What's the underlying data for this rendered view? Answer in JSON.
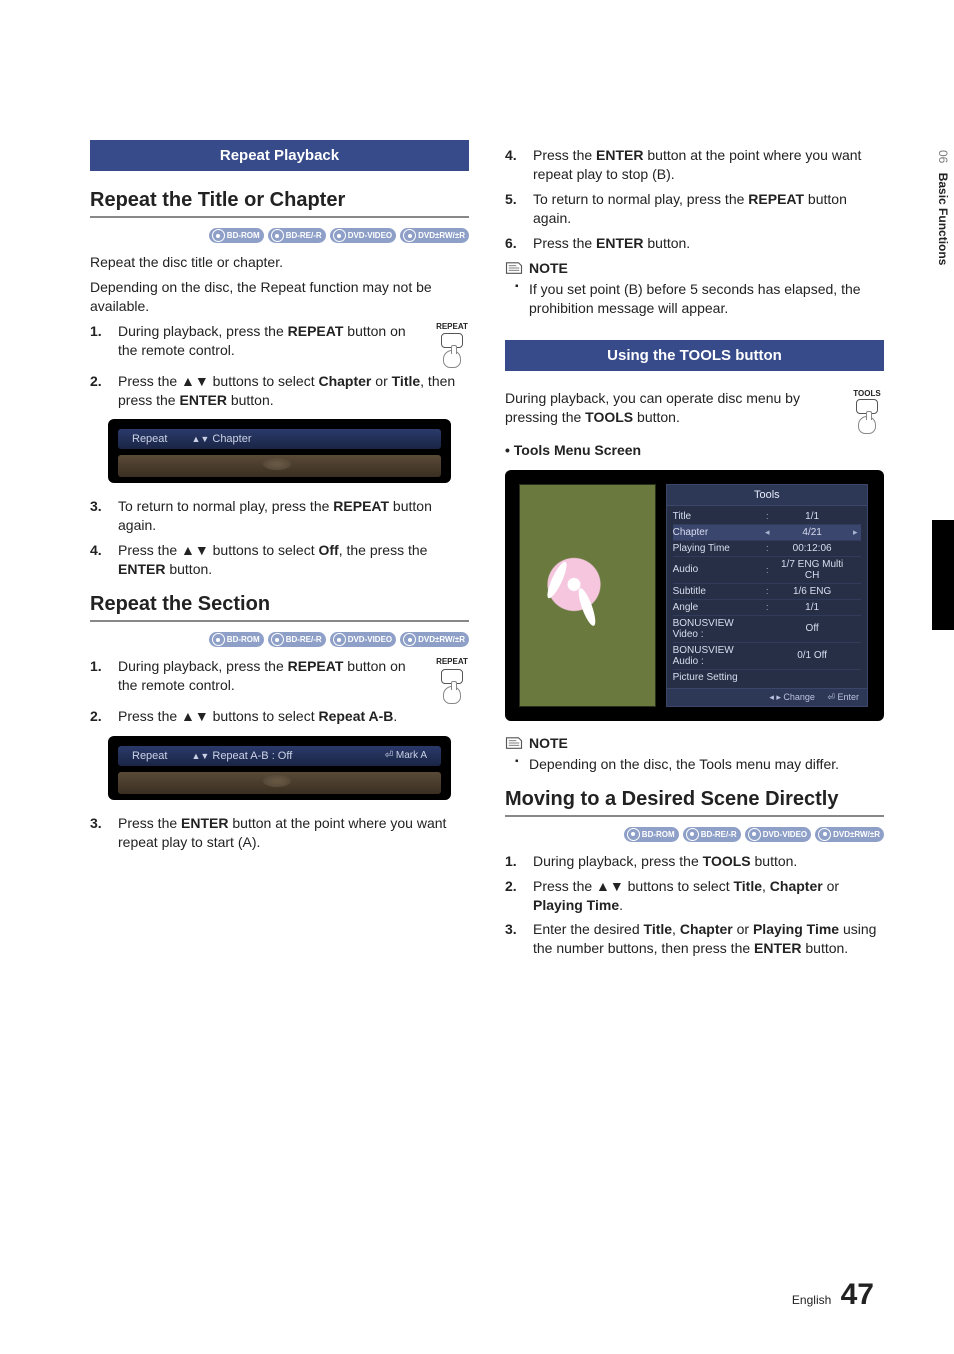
{
  "side": {
    "section_number": "06",
    "section_title": "Basic Functions"
  },
  "footer": {
    "lang": "English",
    "page": "47"
  },
  "left": {
    "banner": "Repeat Playback",
    "h_title_chapter": "Repeat the Title or Chapter",
    "disc_badges": [
      "BD-ROM",
      "BD-RE/-R",
      "DVD-VIDEO",
      "DVD±RW/±R"
    ],
    "intro1": "Repeat the disc title or chapter.",
    "intro2": "Depending on the disc, the Repeat function may not be available.",
    "remote_btn_label": "REPEAT",
    "steps_a": [
      {
        "n": "1.",
        "pre": "During playback, press the ",
        "bold": "REPEAT",
        "post": " button on the remote control."
      },
      {
        "n": "2.",
        "parts": [
          "Press the ",
          "▲▼",
          " buttons to select ",
          "Chapter",
          " or ",
          "Title",
          ", then press the ",
          "ENTER",
          " button."
        ]
      },
      {
        "n": "3.",
        "parts": [
          "To return to normal play, press the ",
          "REPEAT",
          " button again."
        ]
      },
      {
        "n": "4.",
        "parts": [
          "Press the ",
          "▲▼",
          " buttons to select ",
          "Off",
          ", the press the ",
          "ENTER",
          " button."
        ]
      }
    ],
    "osd1": {
      "label": "Repeat",
      "arrows": "▲▼",
      "value": "Chapter"
    },
    "h_section": "Repeat the Section",
    "disc_badges2": [
      "BD-ROM",
      "BD-RE/-R",
      "DVD-VIDEO",
      "DVD±RW/±R"
    ],
    "steps_b": [
      {
        "n": "1.",
        "parts": [
          "During playback, press the ",
          "REPEAT",
          " button on the remote control."
        ]
      },
      {
        "n": "2.",
        "parts": [
          "Press the ",
          "▲▼",
          " buttons to select ",
          "Repeat A-B",
          "."
        ]
      },
      {
        "n": "3.",
        "parts": [
          "Press the ",
          "ENTER",
          " button at the point where you want repeat play to start (A)."
        ]
      }
    ],
    "osd2": {
      "label": "Repeat",
      "arrows": "▲▼",
      "value": "Repeat A-B : Off",
      "enter_glyph": "⏎",
      "enter_label": "Mark A"
    }
  },
  "right": {
    "steps_c": [
      {
        "n": "4.",
        "parts": [
          "Press the ",
          "ENTER",
          " button at the point where you want repeat play to stop (B)."
        ]
      },
      {
        "n": "5.",
        "parts": [
          "To return to normal play, press the ",
          "REPEAT",
          " button again."
        ]
      },
      {
        "n": "6.",
        "parts": [
          "Press the ",
          "ENTER",
          " button."
        ]
      }
    ],
    "note_label": "NOTE",
    "note1": "If you set point (B) before 5 seconds has elapsed, the prohibition message will appear.",
    "banner": "Using the TOOLS button",
    "remote_btn_label": "TOOLS",
    "intro_parts": [
      "During playback, you can operate disc menu by pressing the ",
      "TOOLS",
      " button."
    ],
    "tools_heading": "• Tools Menu Screen",
    "tools_panel": {
      "title": "Tools",
      "rows": [
        {
          "label": "Title",
          "sep": ":",
          "value": "1/1"
        },
        {
          "label": "Chapter",
          "left_ar": "◂",
          "value": "4/21",
          "right_ar": "▸",
          "highlight": true
        },
        {
          "label": "Playing Time",
          "sep": ":",
          "value": "00:12:06"
        },
        {
          "label": "Audio",
          "sep": ":",
          "value": "1/7 ENG Multi CH"
        },
        {
          "label": "Subtitle",
          "sep": ":",
          "value": "1/6 ENG"
        },
        {
          "label": "Angle",
          "sep": ":",
          "value": "1/1"
        },
        {
          "label": "BONUSVIEW Video :",
          "value": "Off"
        },
        {
          "label": "BONUSVIEW Audio :",
          "value": "0/1 Off"
        },
        {
          "label": "Picture Setting",
          "value": ""
        }
      ],
      "footer_change_glyph": "◂ ▸",
      "footer_change": "Change",
      "footer_enter_glyph": "⏎",
      "footer_enter": "Enter"
    },
    "note2": "Depending on the disc, the Tools menu may differ.",
    "h_scene": "Moving to a Desired Scene Directly",
    "disc_badges": [
      "BD-ROM",
      "BD-RE/-R",
      "DVD-VIDEO",
      "DVD±RW/±R"
    ],
    "steps_d": [
      {
        "n": "1.",
        "parts": [
          "During playback, press the ",
          "TOOLS",
          " button."
        ]
      },
      {
        "n": "2.",
        "parts": [
          "Press the ",
          "▲▼",
          " buttons to select ",
          "Title",
          ", ",
          "Chapter",
          " or ",
          "Playing Time",
          "."
        ]
      },
      {
        "n": "3.",
        "parts": [
          "Enter the desired ",
          "Title",
          ", ",
          "Chapter",
          " or ",
          "Playing Time",
          " using the number buttons, then press the ",
          "ENTER",
          " button."
        ]
      }
    ]
  }
}
